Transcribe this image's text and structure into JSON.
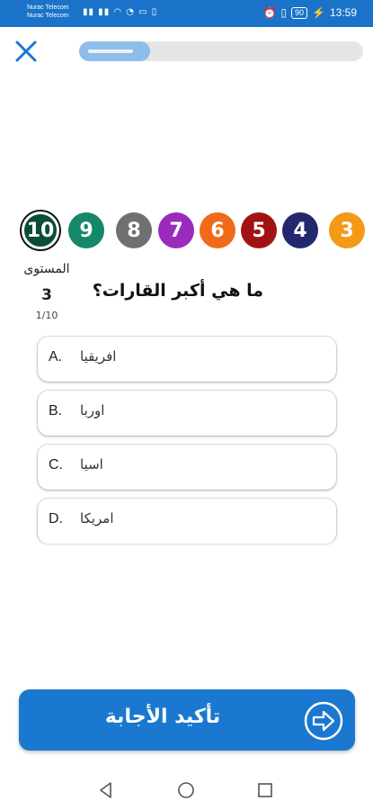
{
  "status_bar": {
    "carrier_1": "Nurac Telecom",
    "carrier_2": "Nurac Telecom",
    "battery": "90",
    "time": "13:59"
  },
  "quiz": {
    "progress_percent": 25
  },
  "levels": [
    {
      "label": "10",
      "color": "#0b4d36"
    },
    {
      "label": "9",
      "color": "#15876b"
    },
    {
      "label": "8",
      "color": "#707070"
    },
    {
      "label": "7",
      "color": "#9b2bbd"
    },
    {
      "label": "6",
      "color": "#f06a1a"
    },
    {
      "label": "5",
      "color": "#a31212"
    },
    {
      "label": "4",
      "color": "#23286e"
    },
    {
      "label": "3",
      "color": "#f39a16"
    }
  ],
  "level_info": {
    "label": "المستوى",
    "value": "3",
    "progress": "1/10"
  },
  "question": "ما هي أكبر القارات؟",
  "answers": [
    {
      "letter": "A.",
      "text": "افريقيا"
    },
    {
      "letter": "B.",
      "text": "اوربا"
    },
    {
      "letter": "C.",
      "text": "اسيا"
    },
    {
      "letter": "D.",
      "text": "امريكا"
    }
  ],
  "confirm_button": {
    "label": "تأكيد الأجابة"
  },
  "colors": {
    "status_bar": "#1a73c9",
    "accent": "#1b78d0",
    "progress_fill": "#8fbde9"
  }
}
